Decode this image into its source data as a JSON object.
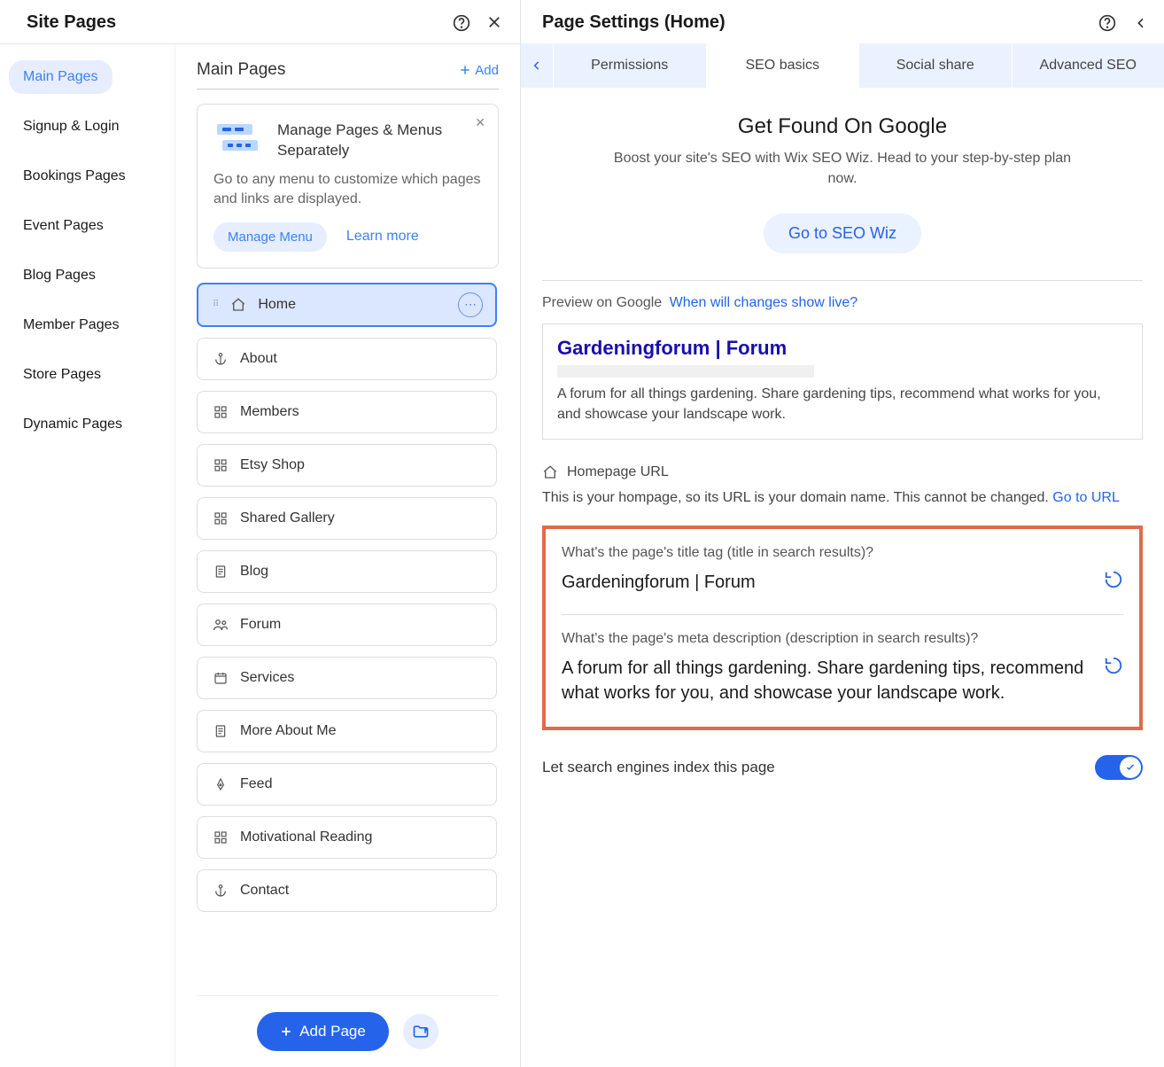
{
  "left": {
    "title": "Site Pages",
    "nav": {
      "items": [
        {
          "label": "Main Pages",
          "active": true
        },
        {
          "label": "Signup & Login"
        },
        {
          "label": "Bookings Pages"
        },
        {
          "label": "Event Pages"
        },
        {
          "label": "Blog Pages"
        },
        {
          "label": "Member Pages"
        },
        {
          "label": "Store Pages"
        },
        {
          "label": "Dynamic Pages"
        }
      ]
    },
    "main": {
      "title": "Main Pages",
      "add": "Add",
      "callout": {
        "title": "Manage Pages & Menus Separately",
        "text": "Go to any menu to customize which pages and links are displayed.",
        "btn": "Manage Menu",
        "learn": "Learn more"
      },
      "pages": [
        {
          "label": "Home",
          "icon": "home",
          "selected": true
        },
        {
          "label": "About",
          "icon": "anchor"
        },
        {
          "label": "Members",
          "icon": "grid"
        },
        {
          "label": "Etsy Shop",
          "icon": "grid"
        },
        {
          "label": "Shared Gallery",
          "icon": "grid"
        },
        {
          "label": "Blog",
          "icon": "doc"
        },
        {
          "label": "Forum",
          "icon": "people"
        },
        {
          "label": "Services",
          "icon": "calendar"
        },
        {
          "label": "More About Me",
          "icon": "doc"
        },
        {
          "label": "Feed",
          "icon": "pen"
        },
        {
          "label": "Motivational Reading",
          "icon": "grid"
        },
        {
          "label": "Contact",
          "icon": "anchor"
        }
      ],
      "addPage": "Add Page"
    }
  },
  "right": {
    "title": "Page Settings (Home)",
    "tabs": {
      "items": [
        "Permissions",
        "SEO basics",
        "Social share",
        "Advanced SEO"
      ],
      "active": 1
    },
    "seo": {
      "heroTitle": "Get Found On Google",
      "heroText": "Boost your site's SEO with Wix SEO Wiz. Head to your step-by-step plan now.",
      "wizBtn": "Go to SEO Wiz",
      "previewLabel": "Preview on Google",
      "previewLink": "When will changes show live?",
      "preview": {
        "title": "Gardeningforum | Forum",
        "desc": "A forum for all things gardening. Share gardening tips, recommend what works for you, and showcase your landscape work."
      },
      "urlLabel": "Homepage URL",
      "urlText": "This is your hompage, so its URL is your domain name. This cannot be changed. ",
      "urlLink": "Go to URL",
      "titleTag": {
        "label": "What's the page's title tag (title in search results)?",
        "value": "Gardeningforum | Forum"
      },
      "metaDesc": {
        "label": "What's the page's meta description (description in search results)?",
        "value": "A forum for all things gardening. Share gardening tips, recommend what works for you, and showcase your landscape work."
      },
      "indexLabel": "Let search engines index this page",
      "indexOn": true
    }
  }
}
